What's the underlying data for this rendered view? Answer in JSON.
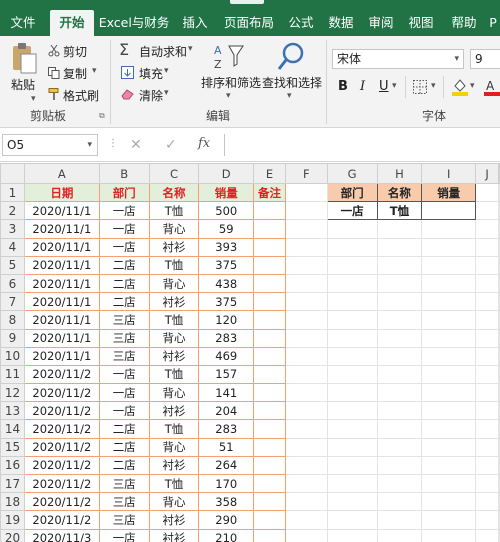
{
  "tabs": [
    "文件",
    "开始",
    "Excel与财务",
    "插入",
    "页面布局",
    "公式",
    "数据",
    "审阅",
    "视图",
    "帮助",
    "P"
  ],
  "active_tab": 1,
  "ribbon": {
    "paste": "粘贴",
    "cut": "剪切",
    "copy": "复制",
    "format_painter": "格式刷",
    "clipboard_group": "剪贴板",
    "autosum": "自动求和",
    "fill": "填充",
    "clear": "清除",
    "sort_filter": "排序和筛选",
    "find_select": "查找和选择",
    "editing_group": "编辑",
    "font_name": "宋体",
    "font_size": "9",
    "bold": "B",
    "italic": "I",
    "underline": "U",
    "font_group": "字体"
  },
  "formula_bar": {
    "name_box": "O5",
    "fx": "fx",
    "cancel": "✕",
    "confirm": "✓"
  },
  "columns": [
    "A",
    "B",
    "C",
    "D",
    "E",
    "F",
    "G",
    "H",
    "I",
    "J"
  ],
  "headers": [
    "日期",
    "部门",
    "名称",
    "销量",
    "备注"
  ],
  "lookup": {
    "headers": [
      "部门",
      "名称",
      "销量"
    ],
    "dept": "一店",
    "name": "T恤",
    "qty": ""
  },
  "rows": [
    [
      "2020/11/1",
      "一店",
      "T恤",
      "500"
    ],
    [
      "2020/11/1",
      "一店",
      "背心",
      "59"
    ],
    [
      "2020/11/1",
      "一店",
      "衬衫",
      "393"
    ],
    [
      "2020/11/1",
      "二店",
      "T恤",
      "375"
    ],
    [
      "2020/11/1",
      "二店",
      "背心",
      "438"
    ],
    [
      "2020/11/1",
      "二店",
      "衬衫",
      "375"
    ],
    [
      "2020/11/1",
      "三店",
      "T恤",
      "120"
    ],
    [
      "2020/11/1",
      "三店",
      "背心",
      "283"
    ],
    [
      "2020/11/1",
      "三店",
      "衬衫",
      "469"
    ],
    [
      "2020/11/2",
      "一店",
      "T恤",
      "157"
    ],
    [
      "2020/11/2",
      "一店",
      "背心",
      "141"
    ],
    [
      "2020/11/2",
      "一店",
      "衬衫",
      "204"
    ],
    [
      "2020/11/2",
      "二店",
      "T恤",
      "283"
    ],
    [
      "2020/11/2",
      "二店",
      "背心",
      "51"
    ],
    [
      "2020/11/2",
      "二店",
      "衬衫",
      "264"
    ],
    [
      "2020/11/2",
      "三店",
      "T恤",
      "170"
    ],
    [
      "2020/11/2",
      "三店",
      "背心",
      "358"
    ],
    [
      "2020/11/2",
      "三店",
      "衬衫",
      "290"
    ],
    [
      "2020/11/3",
      "一店",
      "衬衫",
      "210"
    ]
  ],
  "colors": {
    "accent": "#217346",
    "header_red": "#e02020",
    "header_green_fill": "#e3efda",
    "lookup_fill": "#f8cbad",
    "table_border": "#f4a070"
  }
}
